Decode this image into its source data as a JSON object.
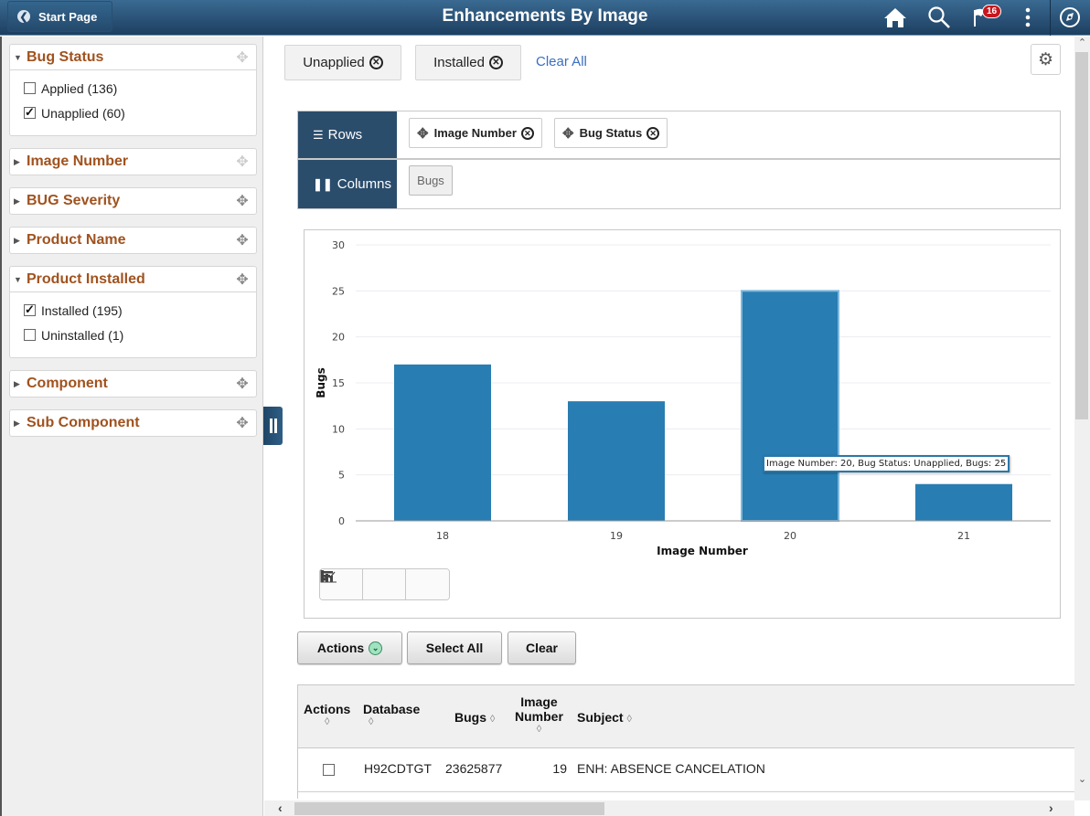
{
  "header": {
    "back_label": "Start Page",
    "title": "Enhancements By Image",
    "notification_count": "16",
    "icons": [
      "home-icon",
      "search-icon",
      "notification-flag-icon",
      "more-options-icon",
      "navbar-compass-icon"
    ]
  },
  "facets": [
    {
      "label": "Bug Status",
      "expanded": true,
      "options": [
        {
          "label": "Applied (136)",
          "checked": false
        },
        {
          "label": "Unapplied (60)",
          "checked": true
        }
      ]
    },
    {
      "label": "Image Number",
      "expanded": false
    },
    {
      "label": "BUG Severity",
      "expanded": false
    },
    {
      "label": "Product Name",
      "expanded": false
    },
    {
      "label": "Product Installed",
      "expanded": true,
      "options": [
        {
          "label": "Installed (195)",
          "checked": true
        },
        {
          "label": "Uninstalled (1)",
          "checked": false
        }
      ]
    },
    {
      "label": "Component",
      "expanded": false
    },
    {
      "label": "Sub Component",
      "expanded": false
    }
  ],
  "filters": {
    "chips": [
      "Unapplied",
      "Installed"
    ],
    "clear_all": "Clear All"
  },
  "pivot": {
    "rows_label": "Rows",
    "columns_label": "Columns",
    "row_fields": [
      "Image Number",
      "Bug Status"
    ],
    "column_fields": [
      "Bugs"
    ]
  },
  "chart_data": {
    "type": "bar",
    "categories": [
      "18",
      "19",
      "20",
      "21"
    ],
    "values": [
      17,
      13,
      25,
      4
    ],
    "xlabel": "Image Number",
    "ylabel": "Bugs",
    "ylim": [
      0,
      30
    ],
    "yticks": [
      "0",
      "5",
      "10",
      "15",
      "20",
      "25",
      "30"
    ],
    "grid": true,
    "color": "#287db2",
    "highlighted_index": 2,
    "tooltip": "Image Number: 20, Bug Status: Unapplied, Bugs: 25"
  },
  "chart_types": [
    "bar-chart-icon",
    "line-chart-icon",
    "horizontal-bar-chart-icon"
  ],
  "actions": {
    "actions_label": "Actions",
    "select_all_label": "Select All",
    "clear_label": "Clear"
  },
  "grid": {
    "headers": {
      "actions": "Actions",
      "database": "Database",
      "bugs": "Bugs",
      "image_number_1": "Image",
      "image_number_2": "Number",
      "subject": "Subject"
    },
    "rows": [
      {
        "checked": false,
        "database": "H92CDTGT",
        "bugs": "23625877",
        "image_number": "19",
        "subject": "ENH: ABSENCE CANCELATION"
      }
    ]
  }
}
